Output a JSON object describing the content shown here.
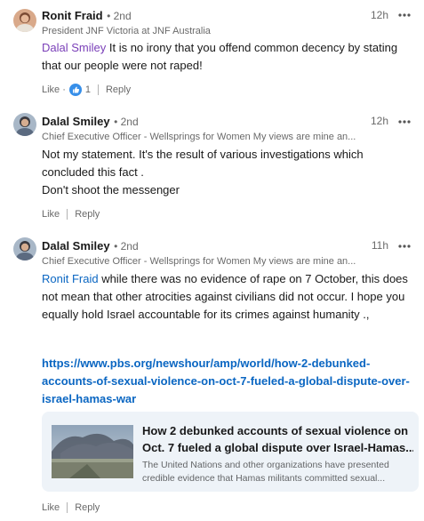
{
  "comments": [
    {
      "author": "Ronit Fraid",
      "degree": "• 2nd",
      "headline": "President JNF Victoria at JNF Australia",
      "time": "12h",
      "mention": "Dalal Smiley",
      "text_lines": [
        " It is no irony that you offend common decency by stating",
        "that our people were not raped!"
      ],
      "like_label": "Like",
      "like_count": "1",
      "reply_label": "Reply"
    },
    {
      "author": "Dalal Smiley",
      "degree": "• 2nd",
      "headline": "Chief Executive Officer - Wellsprings for Women My views are mine an...",
      "time": "12h",
      "text_lines": [
        "Not my statement. It's the result of various investigations which",
        "concluded this fact .",
        "Don't shoot the messenger"
      ],
      "like_label": "Like",
      "reply_label": "Reply"
    },
    {
      "author": "Dalal Smiley",
      "degree": "• 2nd",
      "headline": "Chief Executive Officer - Wellsprings for Women My views are mine an...",
      "time": "11h",
      "mention": "Ronit Fraid",
      "text_lines": [
        " while there was no evidence of rape on 7 October, this does",
        "not mean that other atrocities against civilians did not occur. I hope you",
        "equally hold Israel accountable for its crimes against humanity .,"
      ],
      "link_lines": [
        "https://www.pbs.org/newshour/amp/world/how-2-debunked-",
        "accounts-of-sexual-violence-on-oct-7-fueled-a-global-dispute-over-",
        "israel-hamas-war"
      ],
      "card": {
        "title_lines": [
          "How 2 debunked accounts of sexual violence on",
          "Oct. 7 fueled a global dispute over Israel-Hamas..."
        ],
        "desc_lines": [
          "The United Nations and other organizations have presented",
          "credible evidence that Hamas militants committed sexual..."
        ]
      },
      "like_label": "Like",
      "reply_label": "Reply"
    }
  ],
  "icons": {
    "more": "more-horizontal-icon",
    "like_reaction": "thumbs-up-reaction-icon"
  },
  "colors": {
    "mention_purple": "#7a3fb8",
    "link_blue": "#0a66c2",
    "card_bg": "#eef3f8"
  }
}
